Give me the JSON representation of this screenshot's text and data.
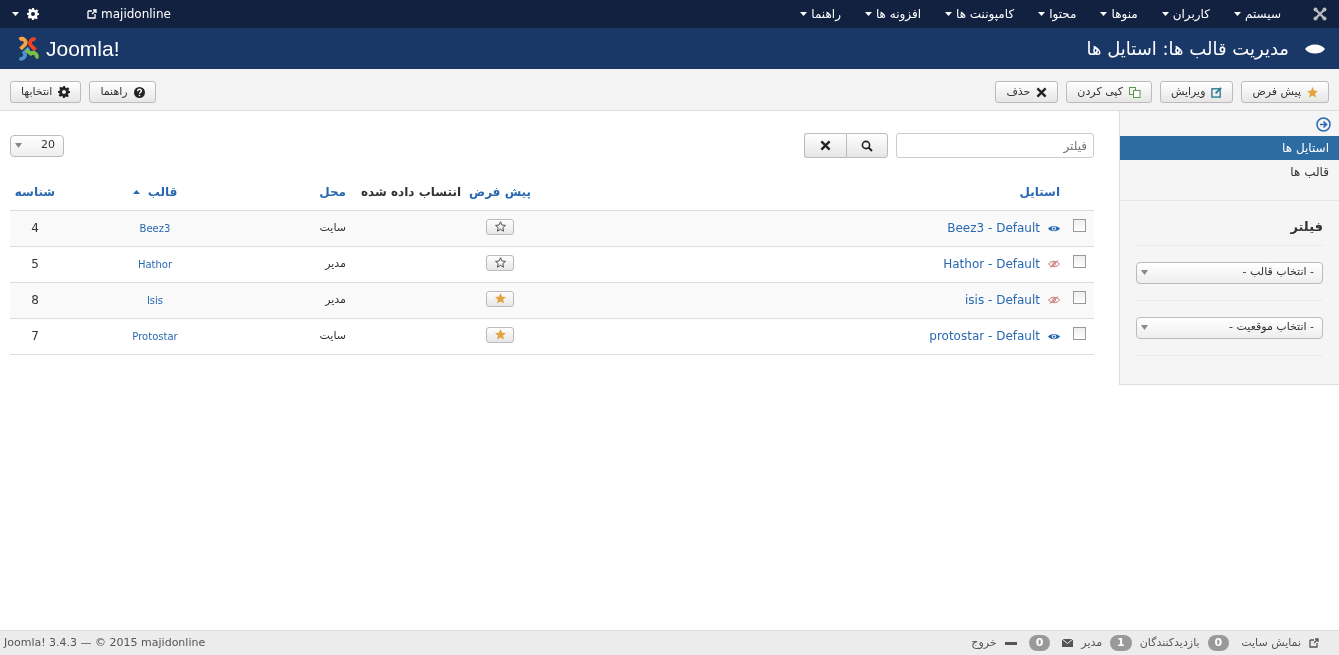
{
  "topbar": {
    "menu": [
      {
        "label": "سیستم"
      },
      {
        "label": "کاربران"
      },
      {
        "label": "منوها"
      },
      {
        "label": "محتوا"
      },
      {
        "label": "کامپوننت ها"
      },
      {
        "label": "افزونه ها"
      },
      {
        "label": "راهنما"
      }
    ],
    "site_link": "majidonline"
  },
  "header": {
    "title": "مدیریت قالب ها: استایل ها",
    "logo": "Joomla!"
  },
  "toolbar": {
    "buttons": [
      {
        "label": "پیش فرض",
        "kind": "star"
      },
      {
        "label": "ویرایش",
        "kind": "edit"
      },
      {
        "label": "کپی کردن",
        "kind": "copy"
      },
      {
        "label": "حذف",
        "kind": "delete"
      }
    ],
    "end_buttons": [
      {
        "label": "راهنما",
        "kind": "help"
      },
      {
        "label": "انتخابها",
        "kind": "options"
      }
    ]
  },
  "sidebar": {
    "items": [
      {
        "label": "استایل ها",
        "selected": true
      },
      {
        "label": "قالب ها",
        "selected": false
      }
    ],
    "filter_title": "فیلتر",
    "selects": [
      {
        "value": "- انتخاب قالب -"
      },
      {
        "value": "- انتخاب موقعیت -"
      }
    ]
  },
  "search": {
    "placeholder": "فیلتر"
  },
  "limit": "20",
  "table": {
    "columns": [
      {
        "label": "استایل",
        "link": true,
        "sorted": false
      },
      {
        "label": "پیش فرض",
        "link": true,
        "sorted": false
      },
      {
        "label": "انتساب داده شده",
        "link": false,
        "sorted": false
      },
      {
        "label": "محل",
        "link": true,
        "sorted": false
      },
      {
        "label": "قالب",
        "link": true,
        "sorted": true
      },
      {
        "label": "شناسه",
        "link": true,
        "sorted": false
      }
    ],
    "rows": [
      {
        "checked": false,
        "style": "Beez3 - Default",
        "preview": true,
        "default": false,
        "location": "سایت",
        "template": "Beez3",
        "id": "4"
      },
      {
        "checked": false,
        "style": "Hathor - Default",
        "preview": false,
        "default": false,
        "location": "مدیر",
        "template": "Hathor",
        "id": "5"
      },
      {
        "checked": false,
        "style": "isis - Default",
        "preview": false,
        "default": true,
        "location": "مدیر",
        "template": "Isis",
        "id": "8"
      },
      {
        "checked": false,
        "style": "protostar - Default",
        "preview": true,
        "default": true,
        "location": "سایت",
        "template": "Protostar",
        "id": "7"
      }
    ]
  },
  "footer": {
    "copyright": "Joomla! 3.4.3 — © 2015 majidonline",
    "status": [
      {
        "kind": "link",
        "label": "نمایش سایت"
      },
      {
        "kind": "badge",
        "label": "0"
      },
      {
        "kind": "text",
        "label": "بازدیدکنندگان"
      },
      {
        "kind": "badge",
        "label": "1"
      },
      {
        "kind": "text",
        "label": "مدیر"
      },
      {
        "kind": "mail"
      },
      {
        "kind": "badge",
        "label": "0"
      },
      {
        "kind": "dash"
      },
      {
        "kind": "text",
        "label": "خروج"
      }
    ]
  }
}
